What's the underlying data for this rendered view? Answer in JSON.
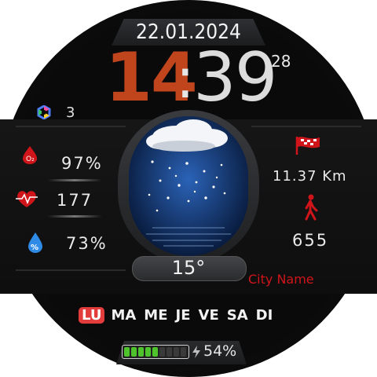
{
  "date": "22.01.2024",
  "time": {
    "hours": "14",
    "separator": ":",
    "minutes": "39",
    "seconds": "28"
  },
  "notifications": {
    "count": "3",
    "icon": "hexagon-icon"
  },
  "left_metrics": [
    {
      "icon": "oxygen-icon",
      "value": "97%"
    },
    {
      "icon": "heart-rate-icon",
      "value": "177"
    },
    {
      "icon": "humidity-icon",
      "value": "73%"
    }
  ],
  "right_metrics": {
    "distance": {
      "icon": "checkered-flag-icon",
      "value": "11.37 Km"
    },
    "steps": {
      "icon": "walking-person-icon",
      "value": "655"
    }
  },
  "weather": {
    "temperature": "15°",
    "icon": "snowy-night-icon",
    "city": "City Name"
  },
  "weekdays": {
    "items": [
      "LU",
      "MA",
      "ME",
      "JE",
      "VE",
      "SA",
      "DI"
    ],
    "active_index": 0
  },
  "battery": {
    "percent_label": "54%",
    "level_fraction": 0.54,
    "icon": "lightning-icon"
  },
  "colors": {
    "hours": "#c0441c",
    "accent_red": "#d0151a",
    "battery_green": "#4fc32c",
    "active_day": "#e23c3c"
  }
}
